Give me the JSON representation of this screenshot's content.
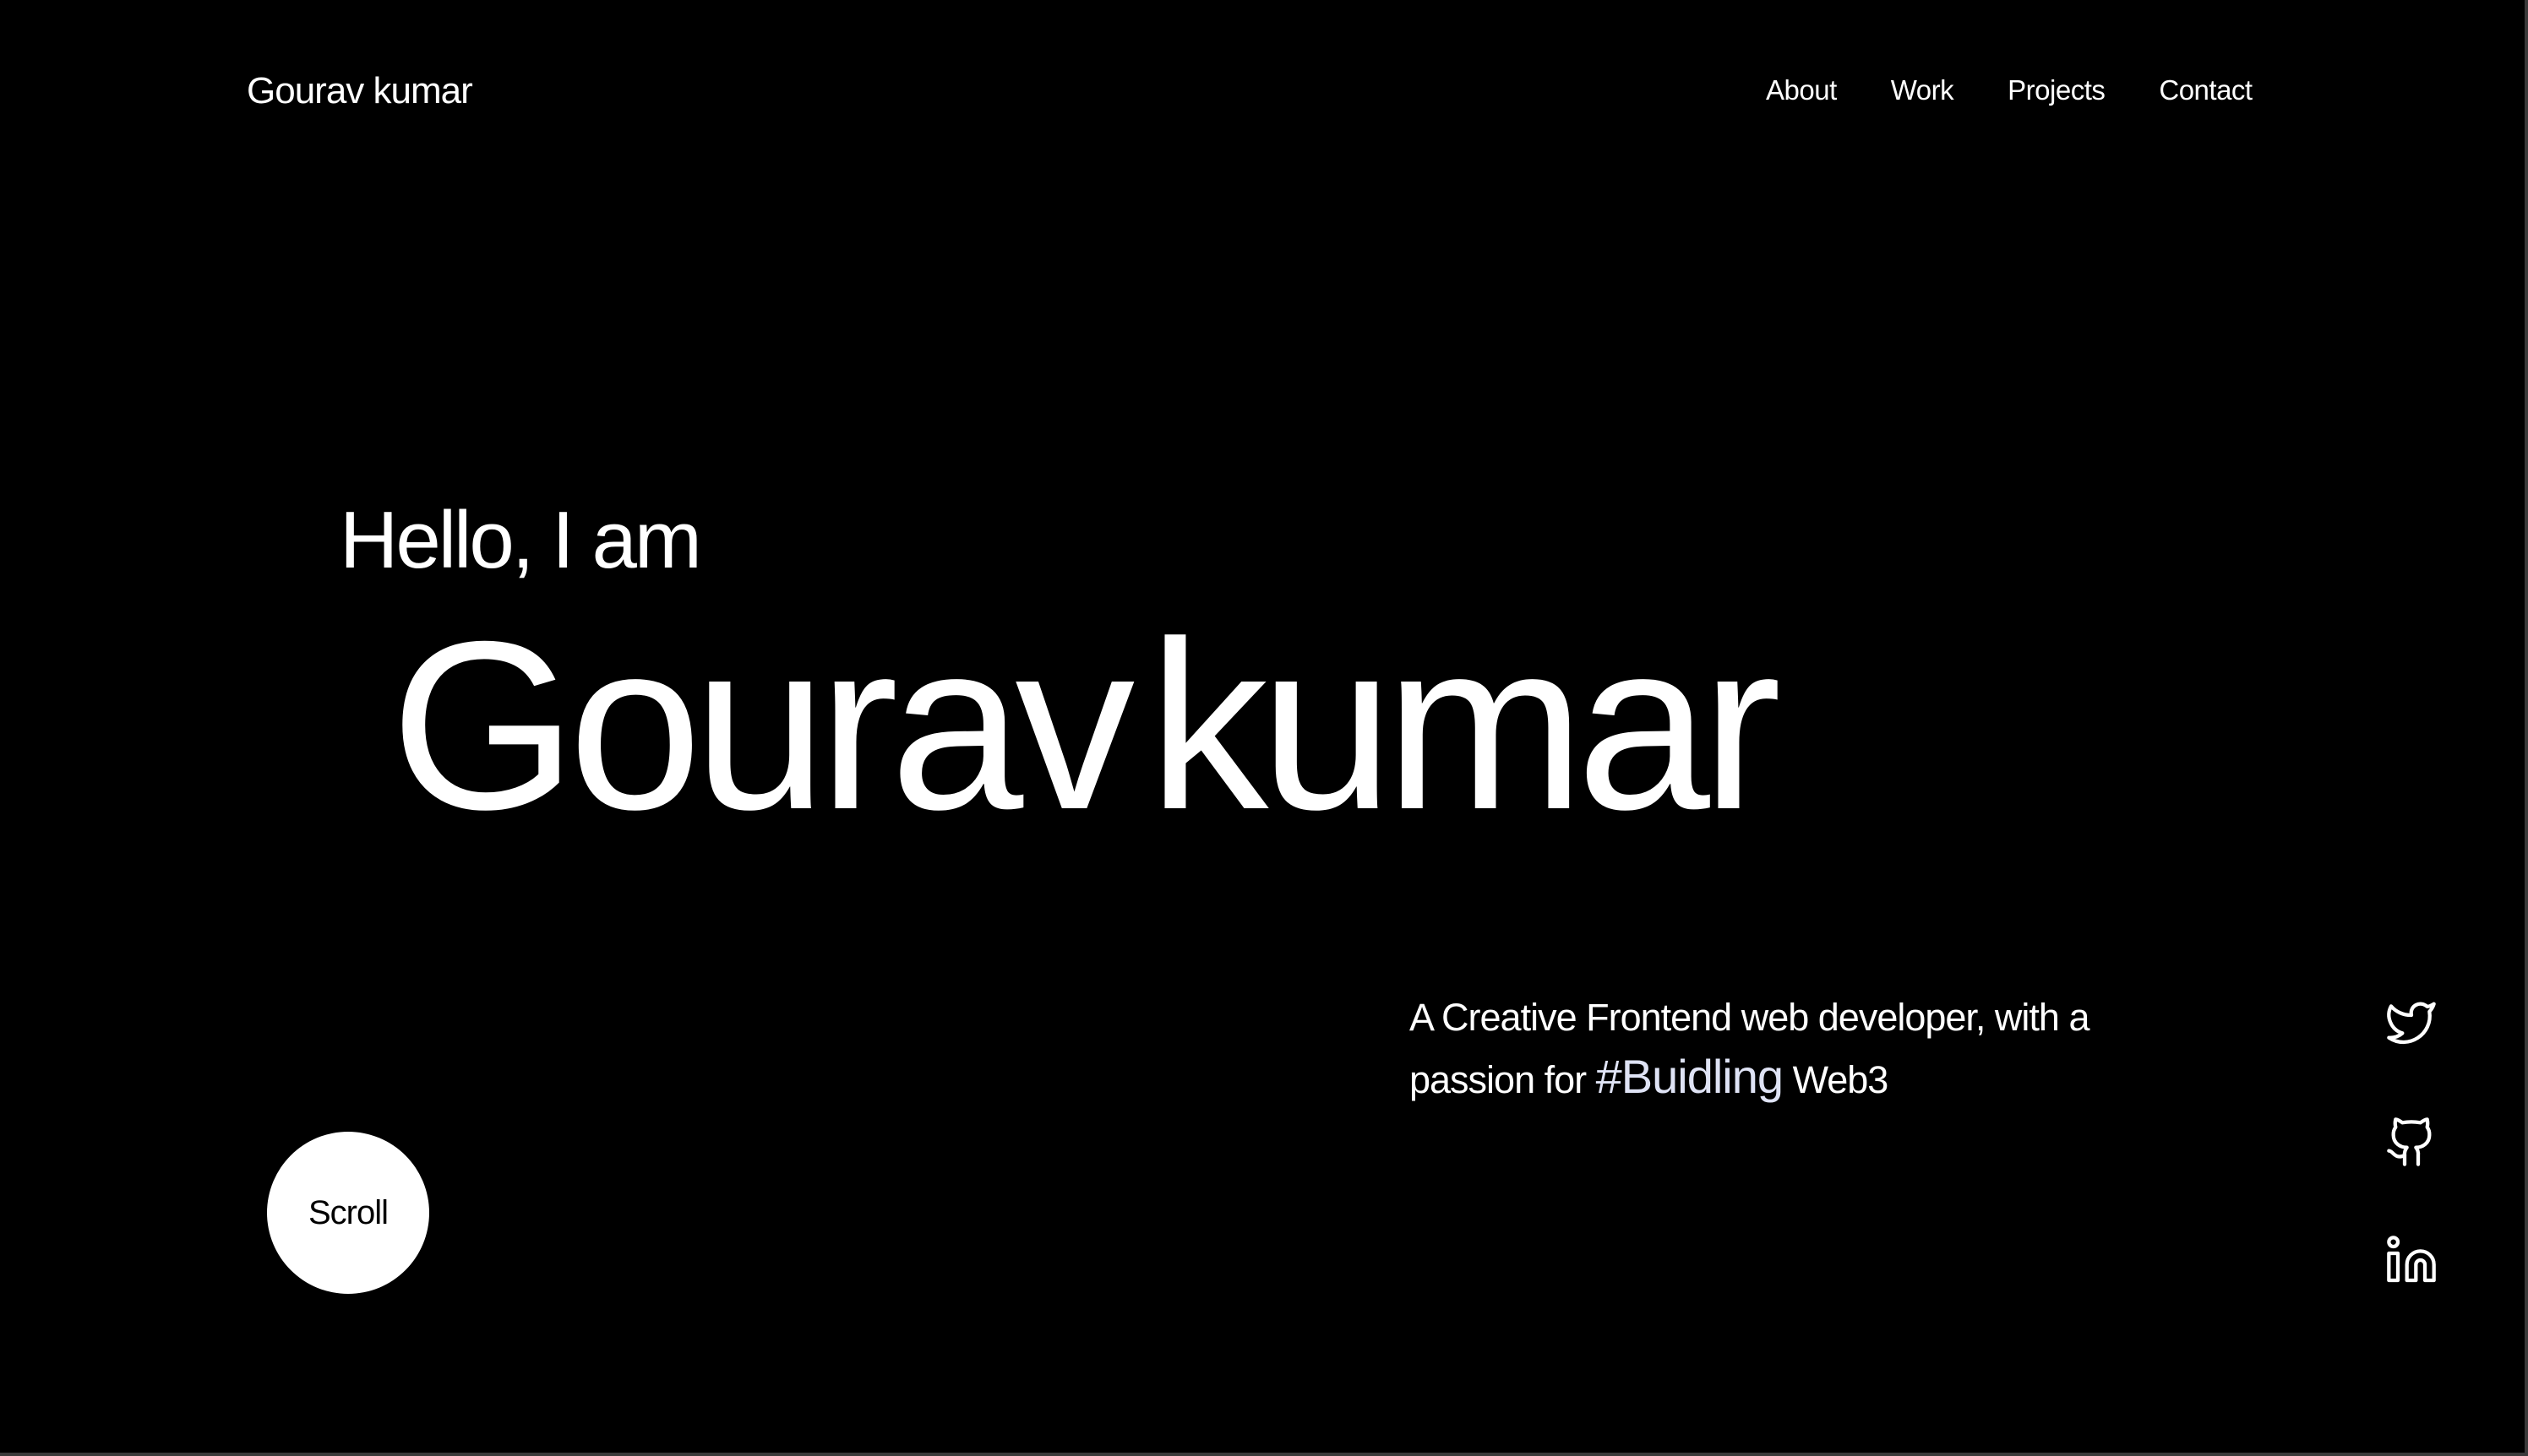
{
  "header": {
    "brand": "Gourav kumar",
    "nav": [
      {
        "label": "About"
      },
      {
        "label": "Work"
      },
      {
        "label": "Projects"
      },
      {
        "label": "Contact"
      }
    ]
  },
  "hero": {
    "greeting": "Hello, I am",
    "first_name": "Gourav",
    "last_name": "kumar",
    "tagline_part1": "A Creative Frontend web developer, with a passion for",
    "hashtag": "#Buidling",
    "tagline_part2": "Web3",
    "scroll_label": "Scroll"
  },
  "social": [
    {
      "icon": "twitter-icon"
    },
    {
      "icon": "github-icon"
    },
    {
      "icon": "linkedin-icon"
    }
  ],
  "colors": {
    "background": "#000000",
    "text": "#ffffff",
    "hashtag": "#dfe3f5"
  }
}
